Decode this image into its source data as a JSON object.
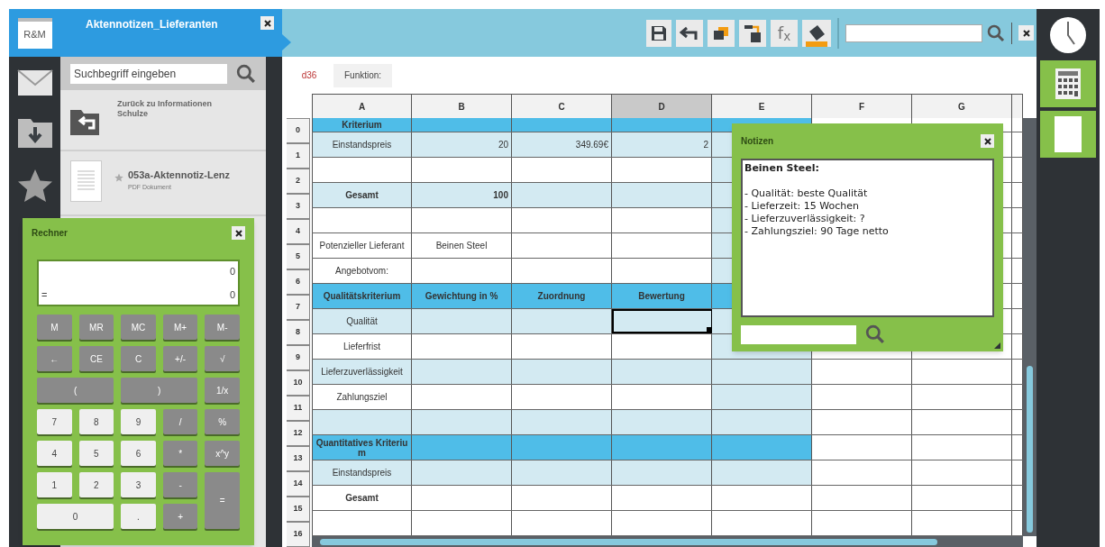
{
  "app": {
    "logo": "R&M"
  },
  "document_tab": {
    "title": "Aktennotizen_Lieferanten"
  },
  "toolbar": {
    "formula_label": "f$_{x}$"
  },
  "sidebar": {
    "search": {
      "placeholder": "Suchbegriff eingeben"
    },
    "items": [
      {
        "kind": "back",
        "title": "Zurück zu Informationen Schulze"
      },
      {
        "kind": "file",
        "title": "053a-Aktennotiz-Lenz",
        "subtitle": "PDF Dokument"
      }
    ]
  },
  "formula_bar": {
    "cell_ref": "d36",
    "label": "Funktion:"
  },
  "sheet": {
    "columns": [
      {
        "label": "A",
        "selected": false
      },
      {
        "label": "B",
        "selected": false
      },
      {
        "label": "C",
        "selected": false
      },
      {
        "label": "D",
        "selected": true
      },
      {
        "label": "E",
        "selected": false
      },
      {
        "label": "F",
        "selected": false
      },
      {
        "label": "G",
        "selected": false
      }
    ],
    "row_numbers": [
      "0",
      "1",
      "2",
      "3",
      "4",
      "5",
      "6",
      "7",
      "8",
      "9",
      "10",
      "11",
      "12",
      "13",
      "14",
      "15",
      "16"
    ],
    "rows": [
      {
        "kind": "title_band",
        "cells": {
          "A": {
            "text": "Kriterium"
          }
        }
      },
      {
        "kind": "shaded",
        "cells": {
          "A": {
            "text": "Einstandspreis"
          },
          "B": {
            "text": "20",
            "kind": "number"
          },
          "C": {
            "text": "349.69€",
            "kind": "number"
          },
          "D": {
            "text": "2",
            "kind": "number"
          }
        }
      },
      {
        "kind": "plain"
      },
      {
        "kind": "shaded",
        "cells": {
          "A": {
            "text": "Gesamt",
            "kind": "total"
          },
          "B": {
            "text": "100",
            "kind": "total_number"
          }
        }
      },
      {
        "kind": "plain"
      },
      {
        "kind": "plain",
        "cells": {
          "A": {
            "text": "Potenzieller Lieferant"
          },
          "B": {
            "text": "Beinen Steel"
          }
        }
      },
      {
        "kind": "plain",
        "cells": {
          "A": {
            "text": "Angebotvom:"
          }
        }
      },
      {
        "kind": "band",
        "cells": {
          "A": {
            "text": "Qualitätskriterium"
          },
          "B": {
            "text": "Gewichtung in %"
          },
          "C": {
            "text": "Zuordnung"
          },
          "D": {
            "text": "Bewertung"
          }
        }
      },
      {
        "kind": "shaded",
        "cells": {
          "A": {
            "text": "Qualität"
          },
          "D": {
            "selected": true
          }
        }
      },
      {
        "kind": "plain",
        "cells": {
          "A": {
            "text": "Lieferfrist"
          }
        }
      },
      {
        "kind": "shaded",
        "cells": {
          "A": {
            "text": "Lieferzuverlässigkeit"
          }
        }
      },
      {
        "kind": "plain",
        "cells": {
          "A": {
            "text": "Zahlungsziel"
          }
        }
      },
      {
        "kind": "shaded"
      },
      {
        "kind": "band",
        "cells": {
          "A": {
            "text": "Quantitatives Kriterium"
          }
        }
      },
      {
        "kind": "shaded",
        "cells": {
          "A": {
            "text": "Einstandspreis"
          }
        }
      },
      {
        "kind": "blank",
        "cells": {
          "A": {
            "text": "Gesamt",
            "kind": "total"
          }
        }
      },
      {
        "kind": "blank"
      }
    ]
  },
  "calculator": {
    "title": "Rechner",
    "display": {
      "expression": "0",
      "prefix": "=",
      "result": "0"
    },
    "keys": [
      {
        "label": "M",
        "kind": "op"
      },
      {
        "label": "MR",
        "kind": "op"
      },
      {
        "label": "MC",
        "kind": "op"
      },
      {
        "label": "M+",
        "kind": "op"
      },
      {
        "label": "M-",
        "kind": "op"
      },
      {
        "label": "←",
        "kind": "op"
      },
      {
        "label": "CE",
        "kind": "op"
      },
      {
        "label": "C",
        "kind": "op"
      },
      {
        "label": "+/-",
        "kind": "op"
      },
      {
        "label": "√",
        "kind": "op"
      },
      {
        "label": "(",
        "kind": "op",
        "wide": true
      },
      {
        "label": ")",
        "kind": "op",
        "wide": true
      },
      {
        "label": "1/x",
        "kind": "op"
      },
      {
        "label": "7",
        "kind": "digit"
      },
      {
        "label": "8",
        "kind": "digit"
      },
      {
        "label": "9",
        "kind": "digit"
      },
      {
        "label": "/",
        "kind": "op"
      },
      {
        "label": "%",
        "kind": "op"
      },
      {
        "label": "4",
        "kind": "digit"
      },
      {
        "label": "5",
        "kind": "digit"
      },
      {
        "label": "6",
        "kind": "digit"
      },
      {
        "label": "*",
        "kind": "op"
      },
      {
        "label": "x^y",
        "kind": "op"
      },
      {
        "label": "1",
        "kind": "digit"
      },
      {
        "label": "2",
        "kind": "digit"
      },
      {
        "label": "3",
        "kind": "digit"
      },
      {
        "label": "-",
        "kind": "op"
      },
      {
        "label": "=",
        "kind": "op",
        "tall": true
      },
      {
        "label": "0",
        "kind": "digit",
        "wide": true
      },
      {
        "label": ".",
        "kind": "digit"
      },
      {
        "label": "+",
        "kind": "op"
      }
    ]
  },
  "notes": {
    "title": "Notizen",
    "heading": "Beinen Steel:",
    "items": [
      "- Qualität: beste Qualität",
      "- Lieferzeit: 15 Wochen",
      "- Lieferzuverlässigkeit: ?",
      "- Zahlungsziel: 90 Tage netto"
    ]
  }
}
